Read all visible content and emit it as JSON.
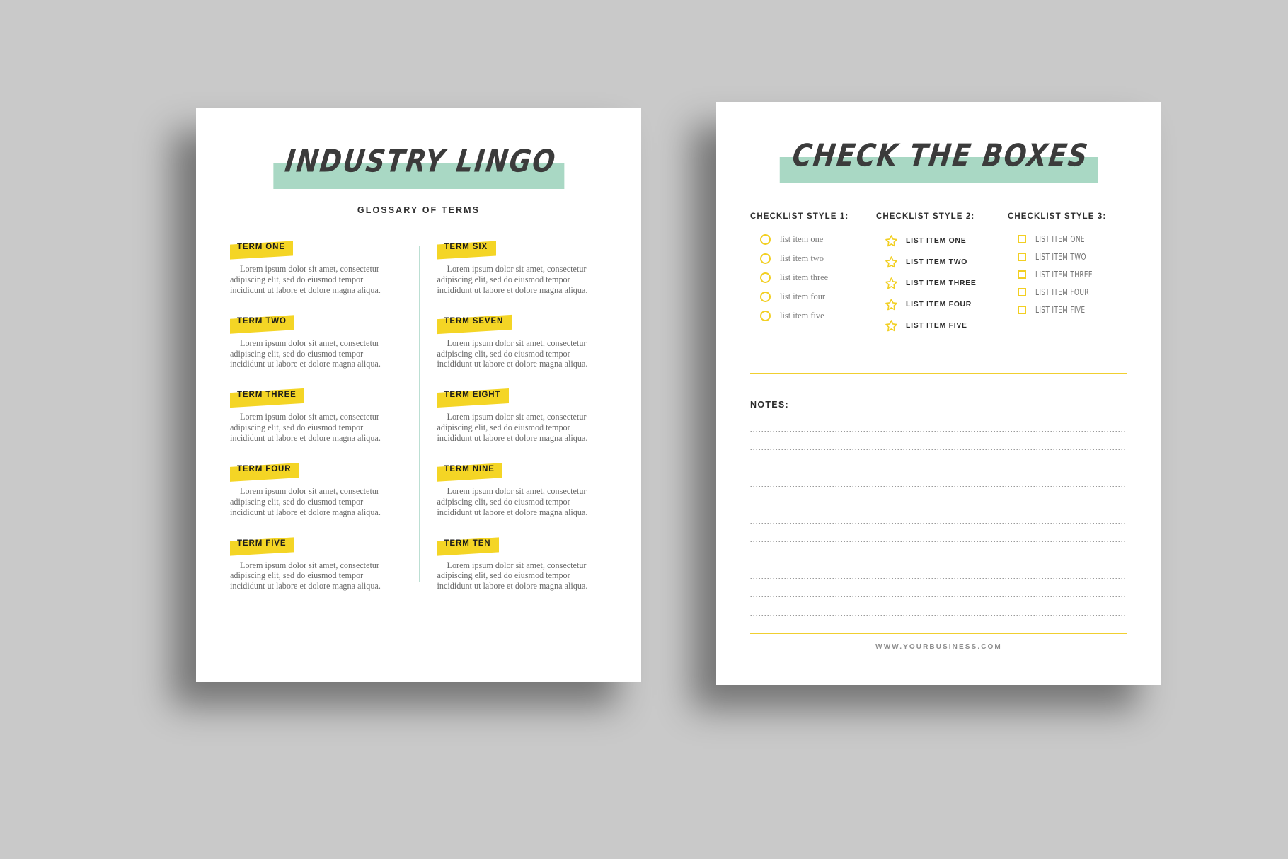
{
  "canvas": {
    "background_color": "#c9c9c9",
    "accent_mint": "#a9d8c4",
    "accent_yellow": "#f4d525",
    "text_dark": "#2b2b2b",
    "text_grey": "#6b6b6b"
  },
  "left_page": {
    "title": "INDUSTRY LINGO",
    "subtitle": "GLOSSARY OF TERMS",
    "body_text": "Lorem ipsum dolor sit amet, consectetur adipiscing elit, sed do eiusmod tempor incididunt ut labore et dolore magna aliqua.",
    "column_one": [
      {
        "term": "TERM ONE",
        "body": "Lorem ipsum dolor sit amet, consectetur adipiscing elit, sed do eiusmod tempor incididunt ut labore et dolore magna aliqua."
      },
      {
        "term": "TERM TWO",
        "body": "Lorem ipsum dolor sit amet, consectetur adipiscing elit, sed do eiusmod tempor incididunt ut labore et dolore magna aliqua."
      },
      {
        "term": "TERM THREE",
        "body": "Lorem ipsum dolor sit amet, consectetur adipiscing elit, sed do eiusmod tempor incididunt ut labore et dolore magna aliqua."
      },
      {
        "term": "TERM FOUR",
        "body": "Lorem ipsum dolor sit amet, consectetur adipiscing elit, sed do eiusmod tempor incididunt ut labore et dolore magna aliqua."
      },
      {
        "term": "TERM FIVE",
        "body": "Lorem ipsum dolor sit amet, consectetur adipiscing elit, sed do eiusmod tempor incididunt ut labore et dolore magna aliqua."
      }
    ],
    "column_two": [
      {
        "term": "TERM SIX",
        "body": "Lorem ipsum dolor sit amet, consectetur adipiscing elit, sed do eiusmod tempor incididunt ut labore et dolore magna aliqua."
      },
      {
        "term": "TERM SEVEN",
        "body": "Lorem ipsum dolor sit amet, consectetur adipiscing elit, sed do eiusmod tempor incididunt ut labore et dolore magna aliqua."
      },
      {
        "term": "TERM EIGHT",
        "body": "Lorem ipsum dolor sit amet, consectetur adipiscing elit, sed do eiusmod tempor incididunt ut labore et dolore magna aliqua."
      },
      {
        "term": "TERM NINE",
        "body": "Lorem ipsum dolor sit amet, consectetur adipiscing elit, sed do eiusmod tempor incididunt ut labore et dolore magna aliqua."
      },
      {
        "term": "TERM TEN",
        "body": "Lorem ipsum dolor sit amet, consectetur adipiscing elit, sed do eiusmod tempor incididunt ut labore et dolore magna aliqua."
      }
    ]
  },
  "right_page": {
    "title": "CHECK THE BOXES",
    "checklists": [
      {
        "heading": "CHECKLIST STYLE 1:",
        "marker_icon": "circle-outline-icon",
        "items": [
          "list item one",
          "list item two",
          "list item three",
          "list item four",
          "list item five"
        ]
      },
      {
        "heading": "CHECKLIST STYLE 2:",
        "marker_icon": "star-outline-icon",
        "items": [
          "LIST ITEM ONE",
          "LIST ITEM TWO",
          "LIST ITEM THREE",
          "LIST ITEM FOUR",
          "LIST ITEM FIVE"
        ]
      },
      {
        "heading": "CHECKLIST STYLE 3:",
        "marker_icon": "square-outline-icon",
        "items": [
          "LIST ITEM ONE",
          "LIST ITEM TWO",
          "LIST ITEM THREE",
          "LIST ITEM FOUR",
          "LIST ITEM FIVE"
        ]
      }
    ],
    "notes_label": "NOTES:",
    "notes_line_count": 11,
    "footer_text": "WWW.YOURBUSINESS.COM"
  }
}
